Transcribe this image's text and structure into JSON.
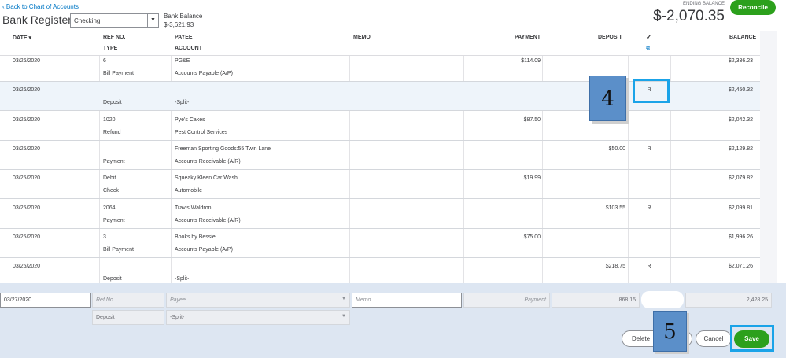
{
  "header": {
    "back_link": "Back to Chart of Accounts",
    "title": "Bank Register",
    "account": "Checking",
    "bank_balance_label": "Bank Balance",
    "bank_balance_value": "$-3,621.93",
    "ending_balance_label": "ENDING BALANCE",
    "ending_balance_value": "$-2,070.35",
    "reconcile_label": "Reconcile"
  },
  "columns": {
    "date": "DATE ▾",
    "ref": "REF NO.",
    "type": "TYPE",
    "payee": "PAYEE",
    "account": "ACCOUNT",
    "memo": "MEMO",
    "payment": "PAYMENT",
    "deposit": "DEPOSIT",
    "check": "✓",
    "balance": "BALANCE"
  },
  "rows": [
    {
      "date": "03/26/2020",
      "ref": "6",
      "type": "Bill Payment",
      "payee": "PG&E",
      "account": "Accounts Payable (A/P)",
      "payment": "$114.09",
      "deposit": "",
      "status": "",
      "balance": "$2,336.23"
    },
    {
      "date": "03/26/2020",
      "ref": "",
      "type": "Deposit",
      "payee": "",
      "account": "-Split-",
      "payment": "",
      "deposit": "",
      "status": "R",
      "balance": "$2,450.32"
    },
    {
      "date": "03/25/2020",
      "ref": "1020",
      "type": "Refund",
      "payee": "Pye's Cakes",
      "account": "Pest Control Services",
      "payment": "$87.50",
      "deposit": "",
      "status": "",
      "balance": "$2,042.32"
    },
    {
      "date": "03/25/2020",
      "ref": "",
      "type": "Payment",
      "payee": "Freeman Sporting Goods:55 Twin Lane",
      "account": "Accounts Receivable (A/R)",
      "payment": "",
      "deposit": "$50.00",
      "status": "R",
      "balance": "$2,129.82"
    },
    {
      "date": "03/25/2020",
      "ref": "Debit",
      "type": "Check",
      "payee": "Squeaky Kleen Car Wash",
      "account": "Automobile",
      "payment": "$19.99",
      "deposit": "",
      "status": "",
      "balance": "$2,079.82"
    },
    {
      "date": "03/25/2020",
      "ref": "2064",
      "type": "Payment",
      "payee": "Travis Waldron",
      "account": "Accounts Receivable (A/R)",
      "payment": "",
      "deposit": "$103.55",
      "status": "R",
      "balance": "$2,099.81"
    },
    {
      "date": "03/25/2020",
      "ref": "3",
      "type": "Bill Payment",
      "payee": "Books by Bessie",
      "account": "Accounts Payable (A/P)",
      "payment": "$75.00",
      "deposit": "",
      "status": "",
      "balance": "$1,996.26"
    },
    {
      "date": "03/25/2020",
      "ref": "",
      "type": "Deposit",
      "payee": "",
      "account": "-Split-",
      "payment": "",
      "deposit": "$218.75",
      "status": "R",
      "balance": "$2,071.26"
    }
  ],
  "edit_row": {
    "date": "03/27/2020",
    "ref_placeholder": "Ref No.",
    "payee_placeholder": "Payee",
    "memo_placeholder": "Memo",
    "payment_placeholder": "Payment",
    "deposit": "868.15",
    "balance": "2,428.25",
    "type": "Deposit",
    "account": "-Split-"
  },
  "buttons": {
    "delete": "Delete",
    "cancel": "Cancel",
    "save": "Save"
  },
  "callouts": {
    "four": "4",
    "five": "5"
  }
}
